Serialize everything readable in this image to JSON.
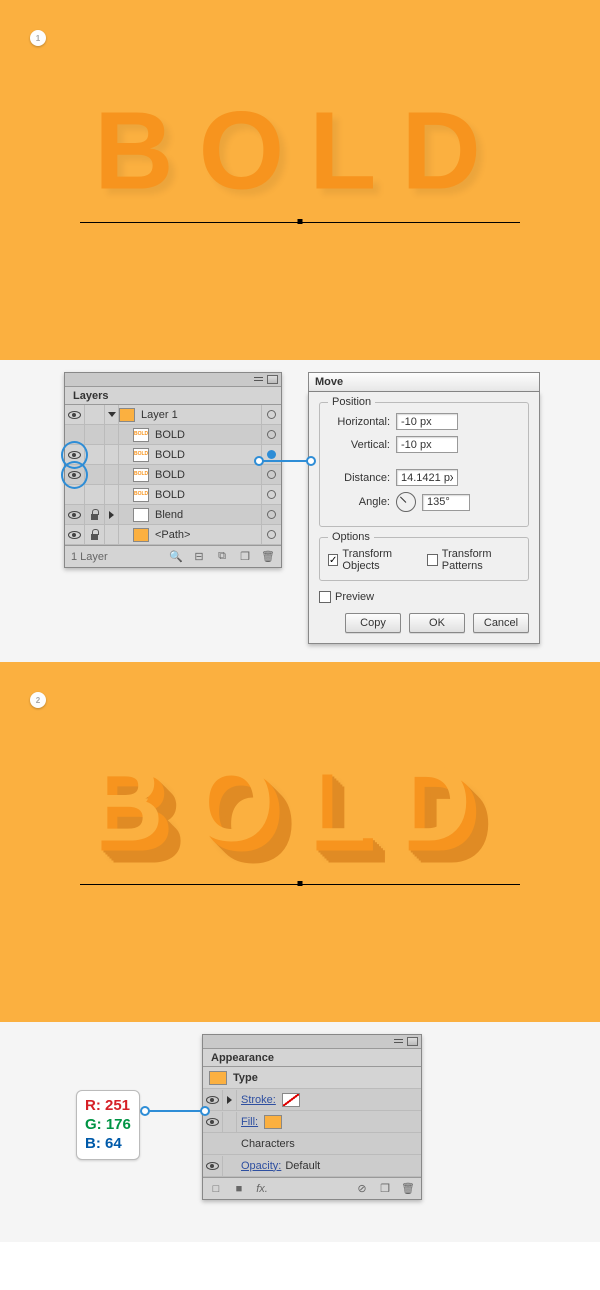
{
  "step1": {
    "badge": "1"
  },
  "step2": {
    "badge": "2"
  },
  "bold_text": "BOLD",
  "layers_panel": {
    "title": "Layers",
    "footer_count": "1 Layer",
    "items": [
      {
        "name": "Layer 1"
      },
      {
        "name": "BOLD"
      },
      {
        "name": "BOLD"
      },
      {
        "name": "BOLD"
      },
      {
        "name": "BOLD"
      },
      {
        "name": "Blend"
      },
      {
        "name": "<Path>"
      }
    ]
  },
  "move_dialog": {
    "title": "Move",
    "position": {
      "legend": "Position",
      "horizontal_label": "Horizontal:",
      "vertical_label": "Vertical:",
      "distance_label": "Distance:",
      "angle_label": "Angle:",
      "horizontal": "-10 px",
      "vertical": "-10 px",
      "distance": "14.1421 px",
      "angle": "135°"
    },
    "options": {
      "legend": "Options",
      "transform_objects": "Transform Objects",
      "transform_patterns": "Transform Patterns"
    },
    "preview": "Preview",
    "buttons": {
      "copy": "Copy",
      "ok": "OK",
      "cancel": "Cancel"
    }
  },
  "appearance_panel": {
    "title": "Appearance",
    "type_label": "Type",
    "stroke_label": "Stroke:",
    "fill_label": "Fill:",
    "characters_label": "Characters",
    "opacity_label": "Opacity:",
    "opacity_value": "Default",
    "fx_label": "fx."
  },
  "rgb": {
    "r": "R: 251",
    "g": "G: 176",
    "b": "B: 64"
  }
}
